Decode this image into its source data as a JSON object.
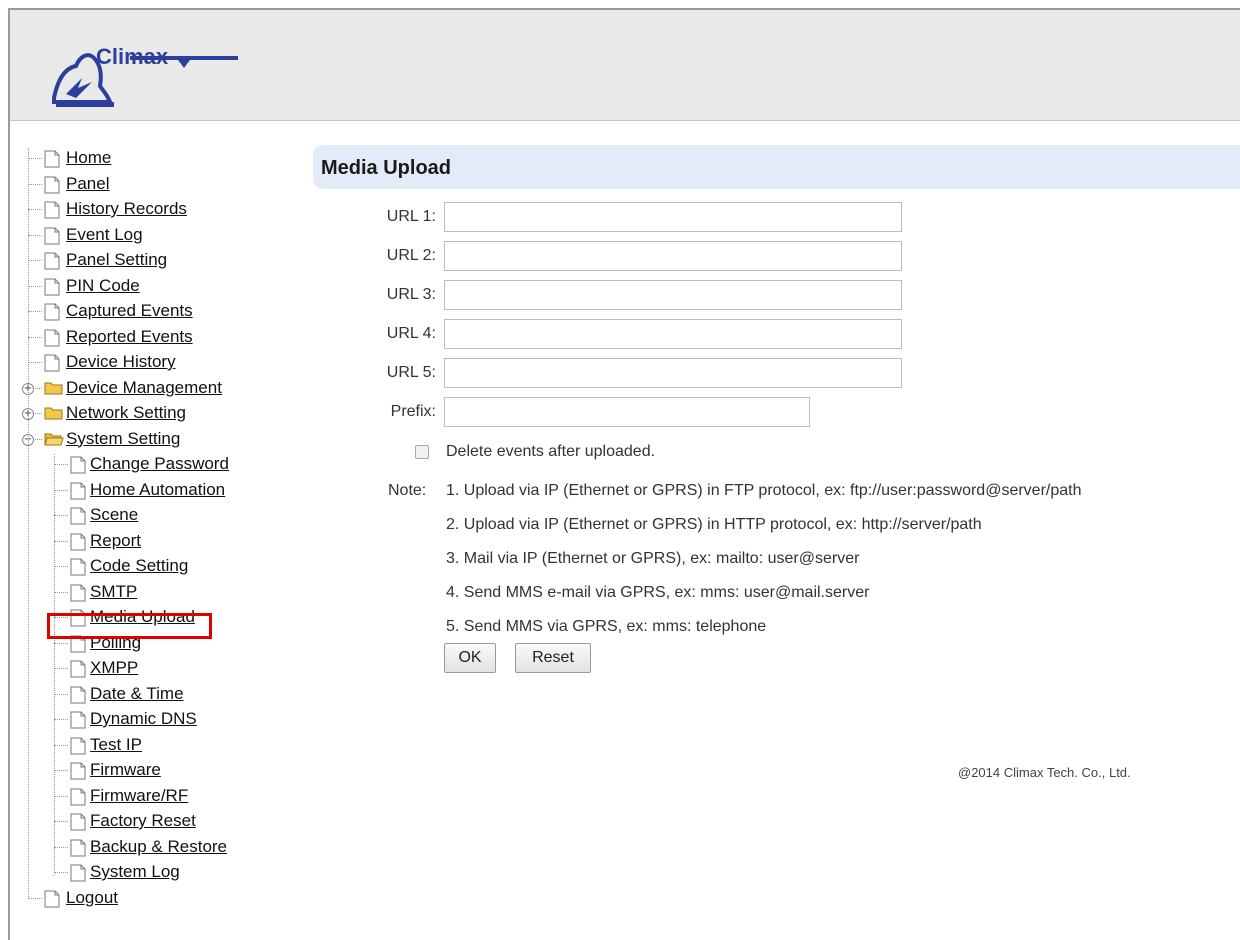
{
  "brand": {
    "logo_text": "Climax"
  },
  "sidebar": {
    "items": [
      {
        "label": "Home"
      },
      {
        "label": "Panel"
      },
      {
        "label": "History Records"
      },
      {
        "label": "Event Log"
      },
      {
        "label": "Panel Setting"
      },
      {
        "label": "PIN Code"
      },
      {
        "label": "Captured Events"
      },
      {
        "label": "Reported Events"
      },
      {
        "label": "Device History"
      },
      {
        "label": "Device Management",
        "folder": true,
        "expanded": false
      },
      {
        "label": "Network Setting",
        "folder": true,
        "expanded": false
      },
      {
        "label": "System Setting",
        "folder": true,
        "expanded": true
      },
      {
        "label": "Logout"
      }
    ],
    "system_children": [
      {
        "label": "Change Password"
      },
      {
        "label": "Home Automation"
      },
      {
        "label": "Scene"
      },
      {
        "label": "Report"
      },
      {
        "label": "Code Setting"
      },
      {
        "label": "SMTP"
      },
      {
        "label": "Media Upload",
        "selected": true
      },
      {
        "label": "Polling"
      },
      {
        "label": "XMPP"
      },
      {
        "label": "Date & Time"
      },
      {
        "label": "Dynamic DNS"
      },
      {
        "label": "Test IP"
      },
      {
        "label": "Firmware"
      },
      {
        "label": "Firmware/RF"
      },
      {
        "label": "Factory Reset"
      },
      {
        "label": "Backup & Restore"
      },
      {
        "label": "System Log"
      }
    ]
  },
  "main": {
    "title": "Media Upload",
    "fields": [
      {
        "label": "URL 1:",
        "value": ""
      },
      {
        "label": "URL 2:",
        "value": ""
      },
      {
        "label": "URL 3:",
        "value": ""
      },
      {
        "label": "URL 4:",
        "value": ""
      },
      {
        "label": "URL 5:",
        "value": ""
      },
      {
        "label": "Prefix:",
        "value": ""
      }
    ],
    "checkbox": {
      "label": "Delete events after uploaded.",
      "checked": false
    },
    "note_label": "Note:",
    "notes": [
      "1. Upload via IP (Ethernet or GPRS) in FTP protocol, ex: ftp://user:password@server/path",
      "2. Upload via IP (Ethernet or GPRS) in HTTP protocol, ex: http://server/path",
      "3. Mail via IP (Ethernet or GPRS), ex: mailto: user@server",
      "4. Send MMS e-mail via GPRS, ex: mms: user@mail.server",
      "5. Send MMS via GPRS, ex: mms: telephone"
    ],
    "ok_label": "OK",
    "reset_label": "Reset"
  },
  "footer": {
    "copyright": "@2014 Climax Tech. Co., Ltd."
  },
  "colors": {
    "title_bar": "#e3ebf8",
    "header": "#e9e9e9",
    "logo": "#2b3f9b",
    "selection_box": "#e00000",
    "folder": "#f2c84b"
  }
}
